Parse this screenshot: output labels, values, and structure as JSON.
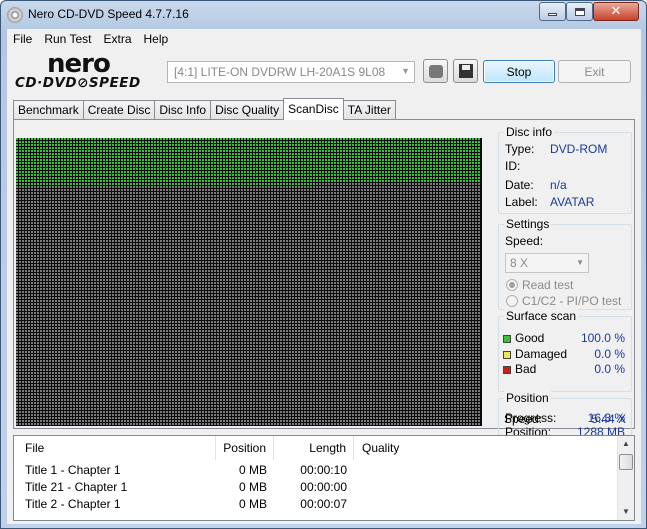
{
  "window": {
    "title": "Nero CD-DVD Speed 4.7.7.16"
  },
  "menu": [
    "File",
    "Run Test",
    "Extra",
    "Help"
  ],
  "logo": {
    "brand": "nero",
    "product": "CD·DVD⊘SPEED"
  },
  "toolbar": {
    "drive": "[4:1]  LITE-ON DVDRW LH-20A1S 9L08",
    "stop_label": "Stop",
    "exit_label": "Exit"
  },
  "tabs": [
    "Benchmark",
    "Create Disc",
    "Disc Info",
    "Disc Quality",
    "ScanDisc",
    "TA Jitter"
  ],
  "active_tab": "ScanDisc",
  "disc_info": {
    "title": "Disc info",
    "type_label": "Type:",
    "type_value": "DVD-ROM",
    "id_label": "ID:",
    "id_value": "",
    "date_label": "Date:",
    "date_value": "n/a",
    "label_label": "Label:",
    "label_value": "AVATAR"
  },
  "settings": {
    "title": "Settings",
    "speed_label": "Speed:",
    "speed_value": "8 X",
    "option_read": "Read test",
    "option_c1c2": "C1/C2 - PI/PO test",
    "selected": "Read test"
  },
  "surface_scan": {
    "title": "Surface scan",
    "good_label": "Good",
    "good_value": "100.0 %",
    "damaged_label": "Damaged",
    "damaged_value": "0.0 %",
    "bad_label": "Bad",
    "bad_value": "0.0 %",
    "colors": {
      "good": "#36c236",
      "damaged": "#e8e85a",
      "bad": "#c81e1e",
      "unscanned": "#7a7a7a"
    }
  },
  "position": {
    "title": "Position",
    "progress_label": "Progress:",
    "progress_value": "16.3 %",
    "position_label": "Position:",
    "position_value": "1288 MB",
    "speed_label": "Speed:",
    "speed_value": "5.44 X"
  },
  "scan_grid": {
    "progress_fraction": 0.163
  },
  "file_table": {
    "headers": [
      "File",
      "Position",
      "Length",
      "Quality"
    ],
    "rows": [
      {
        "file": "Title 1 - Chapter 1",
        "position": "0 MB",
        "length": "00:00:10",
        "quality": ""
      },
      {
        "file": "Title 21 - Chapter 1",
        "position": "0 MB",
        "length": "00:00:00",
        "quality": ""
      },
      {
        "file": "Title 2 - Chapter 1",
        "position": "0 MB",
        "length": "00:00:07",
        "quality": ""
      }
    ]
  }
}
